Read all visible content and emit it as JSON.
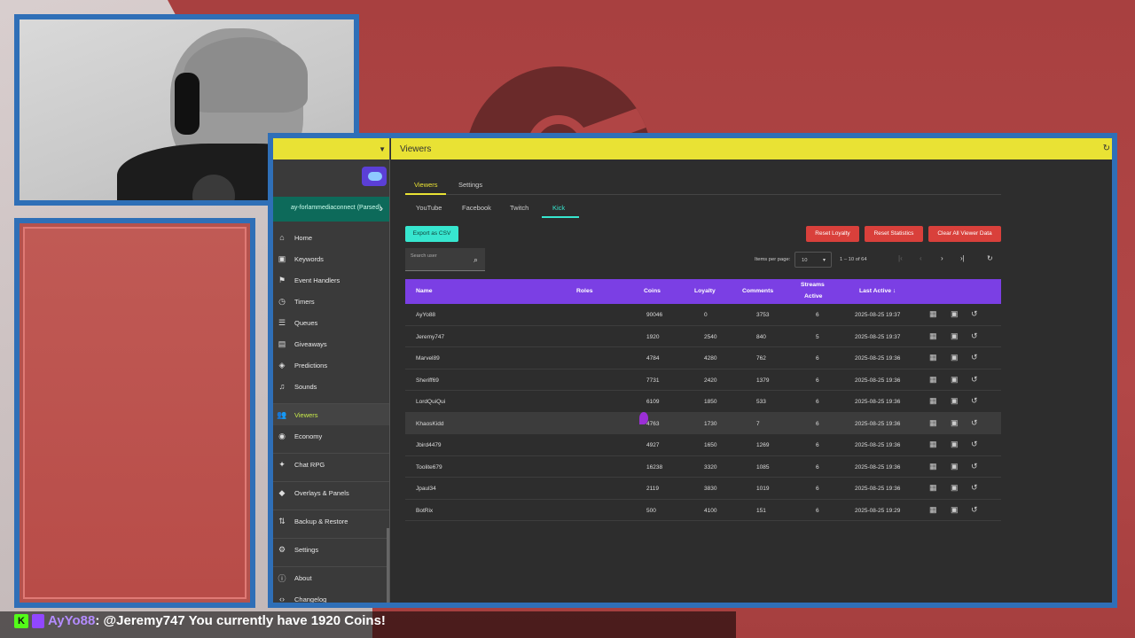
{
  "app": {
    "page_title": "Viewers",
    "sidebar_user": "ay-forlammediaconnect (Parsed)",
    "sidebar_items": [
      {
        "label": "Home",
        "icon": "home-icon"
      },
      {
        "label": "Keywords",
        "icon": "keyword-icon"
      },
      {
        "label": "Event Handlers",
        "icon": "flag-icon"
      },
      {
        "label": "Timers",
        "icon": "timer-icon"
      },
      {
        "label": "Queues",
        "icon": "list-icon"
      },
      {
        "label": "Giveaways",
        "icon": "gift-icon"
      },
      {
        "label": "Predictions",
        "icon": "predictions-icon"
      },
      {
        "label": "Sounds",
        "icon": "sound-icon"
      },
      {
        "label": "Viewers",
        "icon": "viewers-icon"
      },
      {
        "label": "Economy",
        "icon": "economy-icon"
      },
      {
        "label": "Chat RPG",
        "icon": "chat-rpg-icon"
      },
      {
        "label": "Overlays & Panels",
        "icon": "layers-icon"
      },
      {
        "label": "Backup & Restore",
        "icon": "backup-icon"
      },
      {
        "label": "Settings",
        "icon": "settings-icon"
      },
      {
        "label": "About",
        "icon": "info-icon"
      },
      {
        "label": "Changelog",
        "icon": "code-icon"
      }
    ],
    "tabs": [
      "Viewers",
      "Settings"
    ],
    "platform_tabs": [
      "YouTube",
      "Facebook",
      "Twitch",
      "Kick"
    ],
    "buttons": {
      "export_csv": "Export as CSV",
      "reset_loyalty": "Reset Loyalty",
      "reset_statistics": "Reset Statistics",
      "clear_all": "Clear All Viewer Data"
    },
    "search_placeholder": "Search user",
    "pager": {
      "items_per_page_label": "Items per page:",
      "items_per_page_value": "10",
      "range": "1 – 10 of 64"
    },
    "columns": {
      "name": "Name",
      "roles": "Roles",
      "coins": "Coins",
      "loyalty": "Loyalty",
      "comments": "Comments",
      "streams_active_1": "Streams",
      "streams_active_2": "Active",
      "last_active": "Last Active ↓"
    },
    "rows": [
      {
        "name": "AyYo88",
        "coins": "90046",
        "loyalty": "0",
        "comments": "3753",
        "streams": "6",
        "last": "2025-08-25 19:37"
      },
      {
        "name": "Jeremy747",
        "coins": "1920",
        "loyalty": "2540",
        "comments": "840",
        "streams": "5",
        "last": "2025-08-25 19:37"
      },
      {
        "name": "Marvel89",
        "coins": "4784",
        "loyalty": "4280",
        "comments": "762",
        "streams": "6",
        "last": "2025-08-25 19:36"
      },
      {
        "name": "Sheriff69",
        "coins": "7731",
        "loyalty": "2420",
        "comments": "1379",
        "streams": "6",
        "last": "2025-08-25 19:36"
      },
      {
        "name": "LordQuiQui",
        "coins": "6109",
        "loyalty": "1850",
        "comments": "533",
        "streams": "6",
        "last": "2025-08-25 19:36"
      },
      {
        "name": "KhaosKidd",
        "coins": "4763",
        "loyalty": "1730",
        "comments": "7",
        "streams": "6",
        "last": "2025-08-25 19:36"
      },
      {
        "name": "Jbird4479",
        "coins": "4927",
        "loyalty": "1650",
        "comments": "1269",
        "streams": "6",
        "last": "2025-08-25 19:36"
      },
      {
        "name": "Toolite679",
        "coins": "16238",
        "loyalty": "3320",
        "comments": "1085",
        "streams": "6",
        "last": "2025-08-25 19:36"
      },
      {
        "name": "Jpaul34",
        "coins": "2119",
        "loyalty": "3830",
        "comments": "1019",
        "streams": "6",
        "last": "2025-08-25 19:36"
      },
      {
        "name": "BotRix",
        "coins": "500",
        "loyalty": "4100",
        "comments": "151",
        "streams": "6",
        "last": "2025-08-25 19:29"
      }
    ]
  },
  "chat": {
    "username": "AyYo88",
    "message": ": @Jeremy747 You currently have 1920 Coins!"
  },
  "colors": {
    "accent_yellow": "#e9e234",
    "accent_teal": "#37e6cf",
    "header_purple": "#7b3fe4",
    "danger_red": "#d9403b",
    "frame_blue": "#2f6fb7"
  }
}
